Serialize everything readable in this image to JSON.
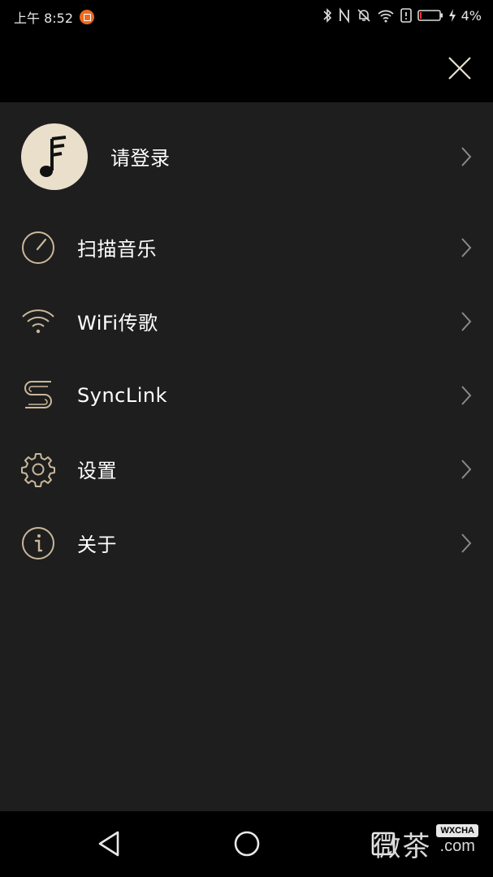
{
  "status_bar": {
    "time": "上午 8:52",
    "battery": "4%"
  },
  "header": {
    "close_icon": "close-icon"
  },
  "menu": {
    "login_label": "请登录",
    "items": [
      {
        "label": "扫描音乐",
        "icon": "scan-gauge-icon"
      },
      {
        "label": "WiFi传歌",
        "icon": "wifi-icon"
      },
      {
        "label": "SyncLink",
        "icon": "synclink-icon"
      },
      {
        "label": "设置",
        "icon": "gear-icon"
      },
      {
        "label": "关于",
        "icon": "info-icon"
      }
    ]
  },
  "watermark": {
    "text": "微茶",
    "badge": "WXCHA",
    "domain": ".com"
  },
  "colors": {
    "background": "#1e1e1e",
    "header": "#000000",
    "accent_gold": "#c9b89a",
    "avatar_bg": "#e9dfcb",
    "notification": "#ee6a1f"
  }
}
